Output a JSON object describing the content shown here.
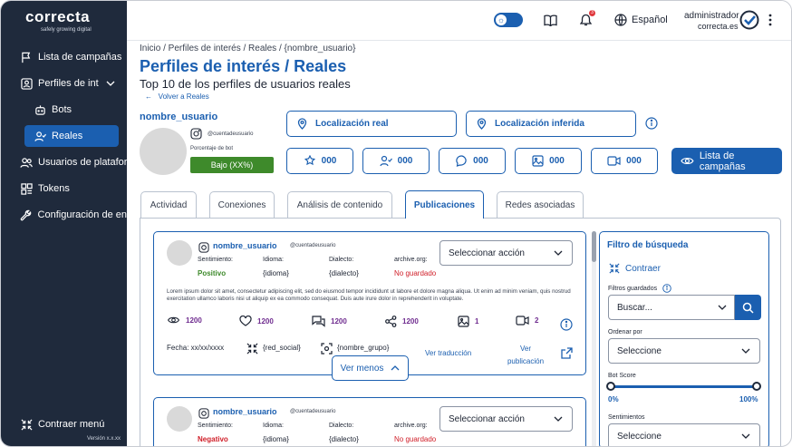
{
  "brand": {
    "name": "correcta",
    "tagline": "safely growing digital"
  },
  "sidebar": {
    "items": [
      {
        "label": "Lista de campañas"
      },
      {
        "label": "Perfiles de int"
      },
      {
        "label": "Bots"
      },
      {
        "label": "Reales"
      },
      {
        "label": "Usuarios de platafor"
      },
      {
        "label": "Tokens"
      },
      {
        "label": "Configuración de en"
      }
    ],
    "collapse_label": "Contraer menú",
    "version": "Versión x.x.xx"
  },
  "topbar": {
    "notifications": "3",
    "language": "Español",
    "user_name": "administrador",
    "user_domain": "correcta.es"
  },
  "breadcrumb": "Inicio / Perfiles de interés / Reales / {nombre_usuario}",
  "page_title": "Perfiles de interés / Reales",
  "page_subtitle": "Top 10 de los perfiles de usuarios reales",
  "back_link": "Volver a Reales",
  "profile": {
    "name": "nombre_usuario",
    "handle": "@cuentadeusuario",
    "bot_label": "Porcentaje de bot",
    "bot_value": "Bajo (XX%)",
    "location_real": "Localización real",
    "location_inferred": "Localización inferida",
    "stats": [
      "000",
      "000",
      "000",
      "000",
      "000"
    ],
    "campaigns_button": "Lista de campañas"
  },
  "tabs": [
    "Actividad",
    "Conexiones",
    "Análisis de contenido",
    "Publicaciones",
    "Redes asociadas"
  ],
  "posts": [
    {
      "name": "nombre_usuario",
      "handle": "@cuentadeusuario",
      "labels": {
        "sentiment": "Sentimiento:",
        "language": "Idioma:",
        "dialect": "Dialecto:",
        "archive": "archive.org:"
      },
      "sentiment": "Positivo",
      "language": "{idioma}",
      "dialect": "{dialecto}",
      "archive": "No guardado",
      "action_placeholder": "Seleccionar acción",
      "text": "Lorem ipsum dolor sit amet, consectetur adipiscing elit, sed do eiusmod tempor incididunt ut labore et dolore magna aliqua. Ut enim ad minim veniam, quis nostrud exercitation ullamco laboris nisi ut aliquip ex ea commodo consequat. Duis aute irure dolor in reprehenderit in voluptate.",
      "metrics": {
        "views": "1200",
        "likes": "1200",
        "comments": "1200",
        "shares": "1200",
        "images": "1",
        "videos": "2"
      },
      "date": "Fecha: xx/xx/xxxx",
      "network": "{red_social}",
      "group": "{nombre_grupo}",
      "translate": "Ver traducción",
      "publication": "Ver publicación",
      "less": "Ver menos"
    },
    {
      "name": "nombre_usuario",
      "handle": "@cuentadeusuario",
      "labels": {
        "sentiment": "Sentimiento:",
        "language": "Idioma:",
        "dialect": "Dialecto:",
        "archive": "archive.org:"
      },
      "sentiment": "Negativo",
      "language": "{idioma}",
      "dialect": "{dialecto}",
      "archive": "No guardado",
      "action_placeholder": "Seleccionar acción"
    }
  ],
  "filter": {
    "title": "Filtro de búsqueda",
    "collapse": "Contraer",
    "saved_label": "Filtros guardados",
    "search_placeholder": "Buscar...",
    "order_label": "Ordenar por",
    "order_value": "Seleccione",
    "bot_score_label": "Bot Score",
    "bot_min": "0%",
    "bot_max": "100%",
    "bot_range": [
      0,
      1
    ],
    "sentiments_label": "Sentimientos",
    "sentiments_value": "Seleccione"
  },
  "colors": {
    "primary": "#1b5fb0",
    "sidebar": "#1f2a3c",
    "positive": "#3e8a2b",
    "negative": "#d0202a",
    "metric": "#6f2c8f"
  }
}
